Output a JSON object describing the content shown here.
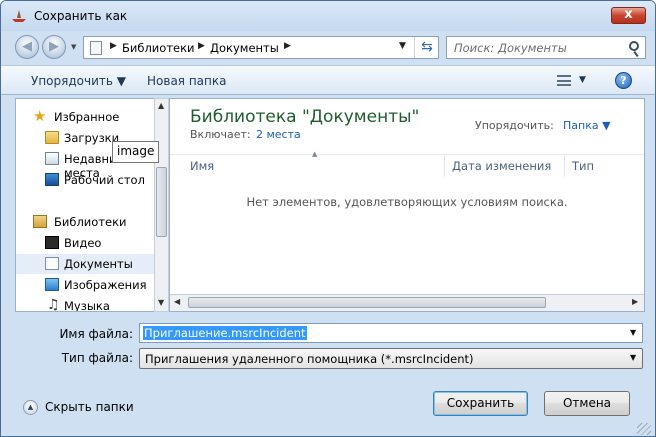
{
  "window": {
    "title": "Сохранить как",
    "close_label": "x"
  },
  "navigation": {
    "back_glyph": "◀",
    "forward_glyph": "▶",
    "history_glyph": "▼",
    "breadcrumb": [
      "Библиотеки",
      "Документы"
    ],
    "separator_glyph": "▶",
    "dropdown_glyph": "▼",
    "refresh_glyph": "⇆",
    "search_placeholder": "Поиск: Документы"
  },
  "toolbar": {
    "organize_label": "Упорядочить ▼",
    "new_folder_label": "Новая папка",
    "views_drop_glyph": "▼",
    "help_label": "?"
  },
  "sidebar": {
    "favorites_label": "Избранное",
    "downloads_label": "Загрузки",
    "recent_label": "Недавние места",
    "desktop_label": "Рабочий стол",
    "libraries_label": "Библиотеки",
    "video_label": "Видео",
    "documents_label": "Документы",
    "images_label": "Изображения",
    "music_label": "Музыка",
    "selected": "Документы",
    "star_glyph": "★",
    "music_glyph": "♫"
  },
  "tooltip": {
    "text": "image"
  },
  "library": {
    "title": "Библиотека \"Документы\"",
    "includes_label": "Включает:",
    "includes_link": "2 места",
    "arrange_label": "Упорядочить:",
    "arrange_value": "Папка ▼"
  },
  "file_list": {
    "sort_glyph": "▲",
    "columns": [
      "Имя",
      "Дата изменения",
      "Тип"
    ],
    "empty_message": "Нет элементов, удовлетворяющих условиям поиска."
  },
  "scroll_glyphs": {
    "up": "▲",
    "down": "▼",
    "left": "◀",
    "right": "▶"
  },
  "form": {
    "filename_label": "Имя файла:",
    "filename_value": "Приглашение.msrcIncident",
    "filetype_label": "Тип файла:",
    "filetype_value": "Приглашения удаленного помощника (*.msrcIncident)",
    "drop_glyph": "▼"
  },
  "footer": {
    "hide_folders_label": "Скрыть папки",
    "hide_glyph": "▲",
    "save_label": "Сохранить",
    "cancel_label": "Отмена"
  }
}
